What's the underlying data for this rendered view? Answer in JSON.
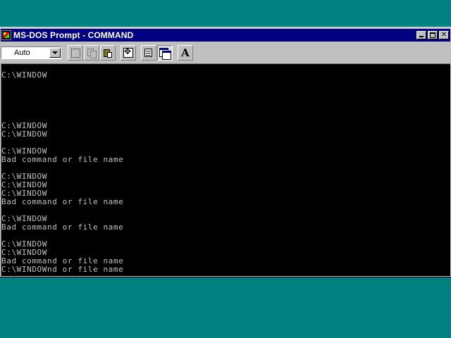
{
  "window": {
    "title": "MS-DOS Prompt - COMMAND"
  },
  "toolbar": {
    "font_size": "Auto",
    "font_button_label": "A"
  },
  "console": {
    "lines": [
      "C:\\WINDOW",
      "",
      "",
      "",
      "",
      "",
      "C:\\WINDOW",
      "C:\\WINDOW",
      "",
      "C:\\WINDOW",
      "Bad command or file name",
      "",
      "C:\\WINDOW",
      "C:\\WINDOW",
      "C:\\WINDOW",
      "Bad command or file name",
      "",
      "C:\\WINDOW",
      "Bad command or file name",
      "",
      "C:\\WINDOW",
      "C:\\WINDOW",
      "Bad command or file name",
      "C:\\WINDOWnd or file name"
    ]
  },
  "colors": {
    "desktop": "#008080",
    "titlebar": "#000080",
    "console_bg": "#000000",
    "console_text": "#c0c0c0"
  },
  "icons": [
    "ms-dos-icon",
    "minimize-icon",
    "maximize-icon",
    "close-icon",
    "mark-icon",
    "copy-icon",
    "paste-icon",
    "full-screen-icon",
    "properties-icon",
    "background-icon",
    "font-icon"
  ]
}
